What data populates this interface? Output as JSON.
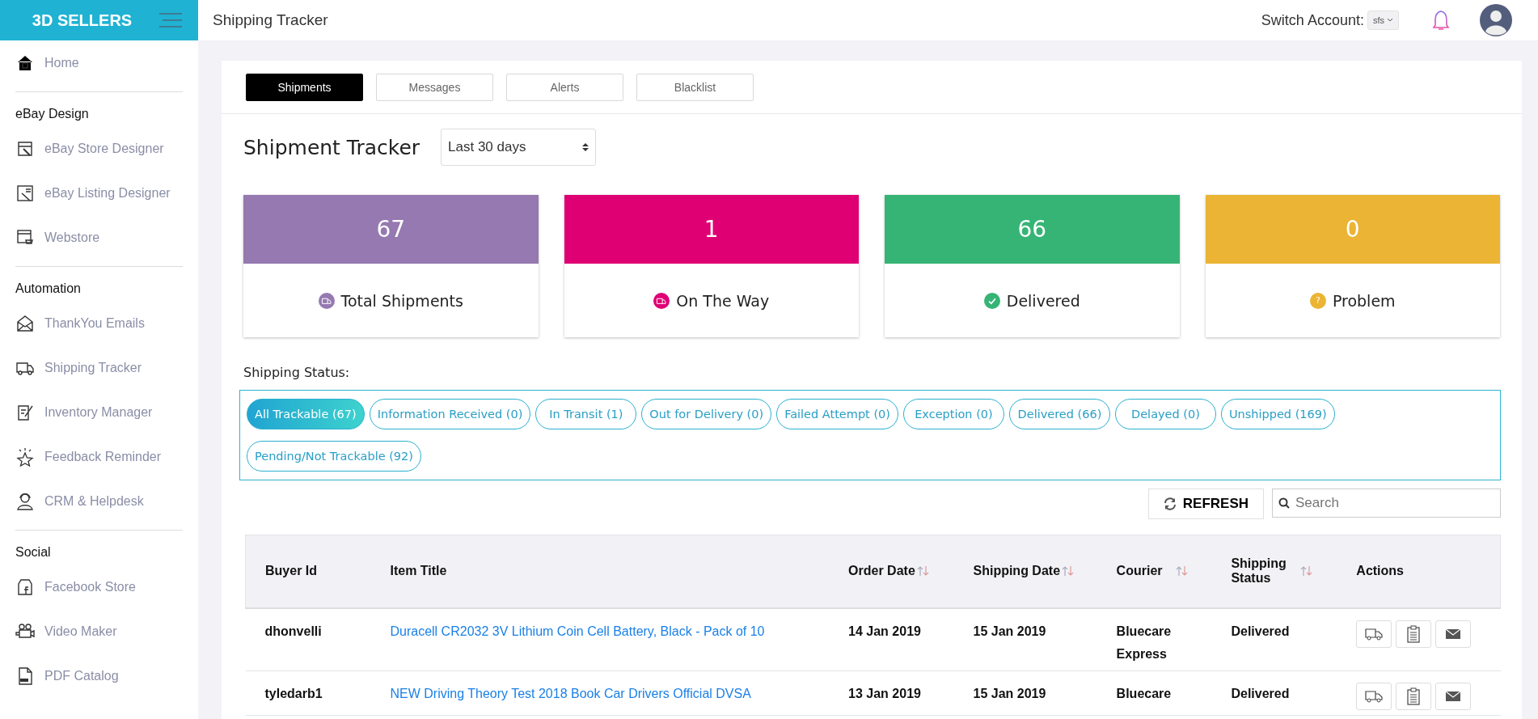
{
  "brand": {
    "name": "3D SELLERS"
  },
  "topbar": {
    "title": "Shipping Tracker",
    "switch_label": "Switch Account:",
    "account": "sfs"
  },
  "sidebar": {
    "sections": [
      {
        "items": [
          {
            "label": "Home"
          }
        ]
      },
      {
        "heading": "eBay Design",
        "items": [
          {
            "label": "eBay Store Designer"
          },
          {
            "label": "eBay Listing Designer"
          },
          {
            "label": "Webstore"
          }
        ]
      },
      {
        "heading": "Automation",
        "items": [
          {
            "label": "ThankYou Emails"
          },
          {
            "label": "Shipping Tracker"
          },
          {
            "label": "Inventory Manager"
          },
          {
            "label": "Feedback Reminder"
          },
          {
            "label": "CRM & Helpdesk"
          }
        ]
      },
      {
        "heading": "Social",
        "items": [
          {
            "label": "Facebook Store"
          },
          {
            "label": "Video Maker"
          },
          {
            "label": "PDF Catalog"
          }
        ]
      }
    ]
  },
  "tabs": [
    {
      "label": "Shipments",
      "selected": true
    },
    {
      "label": "Messages",
      "selected": false
    },
    {
      "label": "Alerts",
      "selected": false
    },
    {
      "label": "Blacklist",
      "selected": false
    }
  ],
  "heading": "Shipment Tracker",
  "period": "Last 30 days",
  "stats": [
    {
      "value": "67",
      "label": "Total Shipments",
      "color": "#9579b0",
      "kind": "truck"
    },
    {
      "value": "1",
      "label": "On The Way",
      "color": "#df0174",
      "kind": "truck"
    },
    {
      "value": "66",
      "label": "Delivered",
      "color": "#36b475",
      "kind": "check"
    },
    {
      "value": "0",
      "label": "Problem",
      "color": "#ebb434",
      "kind": "text",
      "badge": "?"
    }
  ],
  "status_label": "Shipping Status:",
  "filters": [
    {
      "label": "All Trackable (67)",
      "selected": true
    },
    {
      "label": "Information Received (0)",
      "selected": false
    },
    {
      "label": "In Transit (1)",
      "selected": false
    },
    {
      "label": "Out for Delivery (0)",
      "selected": false
    },
    {
      "label": "Failed Attempt (0)",
      "selected": false
    },
    {
      "label": "Exception (0)",
      "selected": false
    },
    {
      "label": "Delivered (66)",
      "selected": false
    },
    {
      "label": "Delayed (0)",
      "selected": false
    },
    {
      "label": "Unshipped (169)",
      "selected": false
    },
    {
      "label": "Pending/Not Trackable (92)",
      "selected": false
    }
  ],
  "refresh": "REFRESH",
  "search": {
    "placeholder": "Search"
  },
  "table": {
    "columns": [
      {
        "label": "Buyer Id"
      },
      {
        "label": "Item Title"
      },
      {
        "label": "Order Date",
        "sortable": true
      },
      {
        "label": "Shipping Date",
        "sortable": true
      },
      {
        "label": "Courier",
        "sortable": true
      },
      {
        "label": "Shipping Status",
        "sortable": true
      },
      {
        "label": "Actions"
      }
    ],
    "rows": [
      {
        "buyer": "dhonvelli",
        "title": "Duracell CR2032 3V Lithium Coin Cell Battery, Black - Pack of 10",
        "order_date": "14 Jan 2019",
        "ship_date": "15 Jan 2019",
        "courier": "Bluecare Express",
        "status": "Delivered"
      },
      {
        "buyer": "tyledarb1",
        "title": "NEW Driving Theory Test 2018 Book Car Drivers Official DVSA",
        "order_date": "13 Jan 2019",
        "ship_date": "15 Jan 2019",
        "courier": "Bluecare",
        "status": "Delivered"
      }
    ]
  }
}
